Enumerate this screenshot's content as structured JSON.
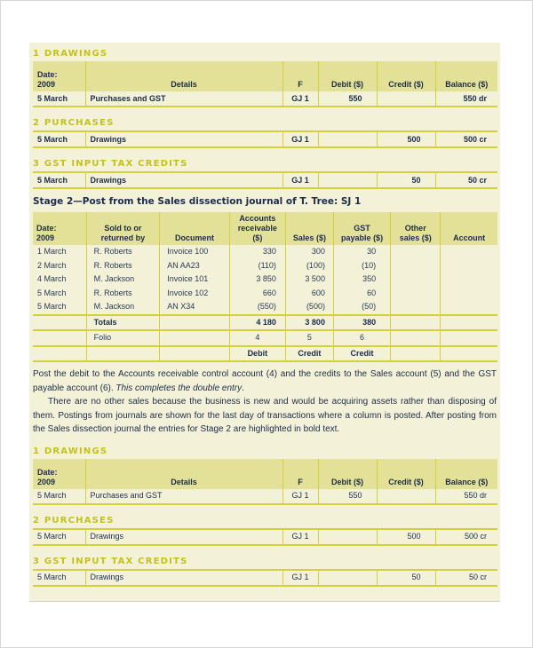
{
  "stage1": {
    "accounts": [
      {
        "heading": "1 DRAWINGS",
        "show_header": true,
        "rows": [
          {
            "date": "5 March",
            "details": "Purchases and GST",
            "f": "GJ 1",
            "debit": "550",
            "credit": "",
            "balance": "550 dr"
          }
        ]
      },
      {
        "heading": "2 PURCHASES",
        "show_header": false,
        "rows": [
          {
            "date": "5 March",
            "details": "Drawings",
            "f": "GJ 1",
            "debit": "",
            "credit": "500",
            "balance": "500 cr"
          }
        ]
      },
      {
        "heading": "3 GST INPUT TAX CREDITS",
        "show_header": false,
        "rows": [
          {
            "date": "5 March",
            "details": "Drawings",
            "f": "GJ 1",
            "debit": "",
            "credit": "50",
            "balance": "50 cr"
          }
        ]
      }
    ]
  },
  "ledger_header": {
    "date_line1": "Date:",
    "date_line2": "2009",
    "details": "Details",
    "f": "F",
    "debit": "Debit ($)",
    "credit": "Credit ($)",
    "balance": "Balance ($)"
  },
  "stage2": {
    "title": "Stage 2—Post from the Sales dissection journal of T. Tree: SJ 1",
    "header": {
      "date_line1": "Date:",
      "date_line2": "2009",
      "sold_line1": "Sold to or",
      "sold_line2": "returned by",
      "document": "Document",
      "ar_line1": "Accounts",
      "ar_line2": "receivable ($)",
      "sales": "Sales ($)",
      "gst_line1": "GST",
      "gst_line2": "payable ($)",
      "other_line1": "Other",
      "other_line2": "sales ($)",
      "account": "Account"
    },
    "rows": [
      {
        "date": "1 March",
        "party": "R. Roberts",
        "document": "Invoice 100",
        "ar": "330",
        "sales": "300",
        "gst": "30",
        "other": "",
        "account": ""
      },
      {
        "date": "2 March",
        "party": "R. Roberts",
        "document": "AN AA23",
        "ar": "(110)",
        "sales": "(100)",
        "gst": "(10)",
        "other": "",
        "account": ""
      },
      {
        "date": "4 March",
        "party": "M. Jackson",
        "document": "Invoice 101",
        "ar": "3 850",
        "sales": "3 500",
        "gst": "350",
        "other": "",
        "account": ""
      },
      {
        "date": "5 March",
        "party": "R. Roberts",
        "document": "Invoice 102",
        "ar": "660",
        "sales": "600",
        "gst": "60",
        "other": "",
        "account": ""
      },
      {
        "date": "5 March",
        "party": "M. Jackson",
        "document": "AN X34",
        "ar": "(550)",
        "sales": "(500)",
        "gst": "(50)",
        "other": "",
        "account": ""
      }
    ],
    "totals": {
      "label": "Totals",
      "ar": "4 180",
      "sales": "3 800",
      "gst": "380"
    },
    "folio": {
      "label": "Folio",
      "ar": "4",
      "sales": "5",
      "gst": "6"
    },
    "side": {
      "ar": "Debit",
      "sales": "Credit",
      "gst": "Credit"
    }
  },
  "text": {
    "p1_a": "Post the debit to the Accounts receivable control account (4) and the credits to the Sales account (5) and the GST payable account (6). ",
    "p1_em": "This completes the double entry",
    "p1_end": ".",
    "p2": "There are no other sales because the business is new and would be acquiring assets rather than disposing of them. Postings from journals are shown for the last day of transactions where a column is posted. After posting from the Sales dissection journal the entries for Stage 2 are highlighted in bold text."
  },
  "stage2_ledger": {
    "accounts": [
      {
        "heading": "1 DRAWINGS",
        "rows": [
          {
            "date": "5 March",
            "details": "Purchases and GST",
            "f": "GJ 1",
            "debit": "550",
            "credit": "",
            "balance": "550 dr"
          }
        ]
      },
      {
        "heading": "2 PURCHASES",
        "rows": [
          {
            "date": "5 March",
            "details": "Drawings",
            "f": "GJ 1",
            "debit": "",
            "credit": "500",
            "balance": "500 cr"
          }
        ]
      },
      {
        "heading": "3 GST INPUT TAX CREDITS",
        "rows": [
          {
            "date": "5 March",
            "details": "Drawings",
            "f": "GJ 1",
            "debit": "",
            "credit": "50",
            "balance": "50 cr"
          }
        ]
      }
    ]
  }
}
